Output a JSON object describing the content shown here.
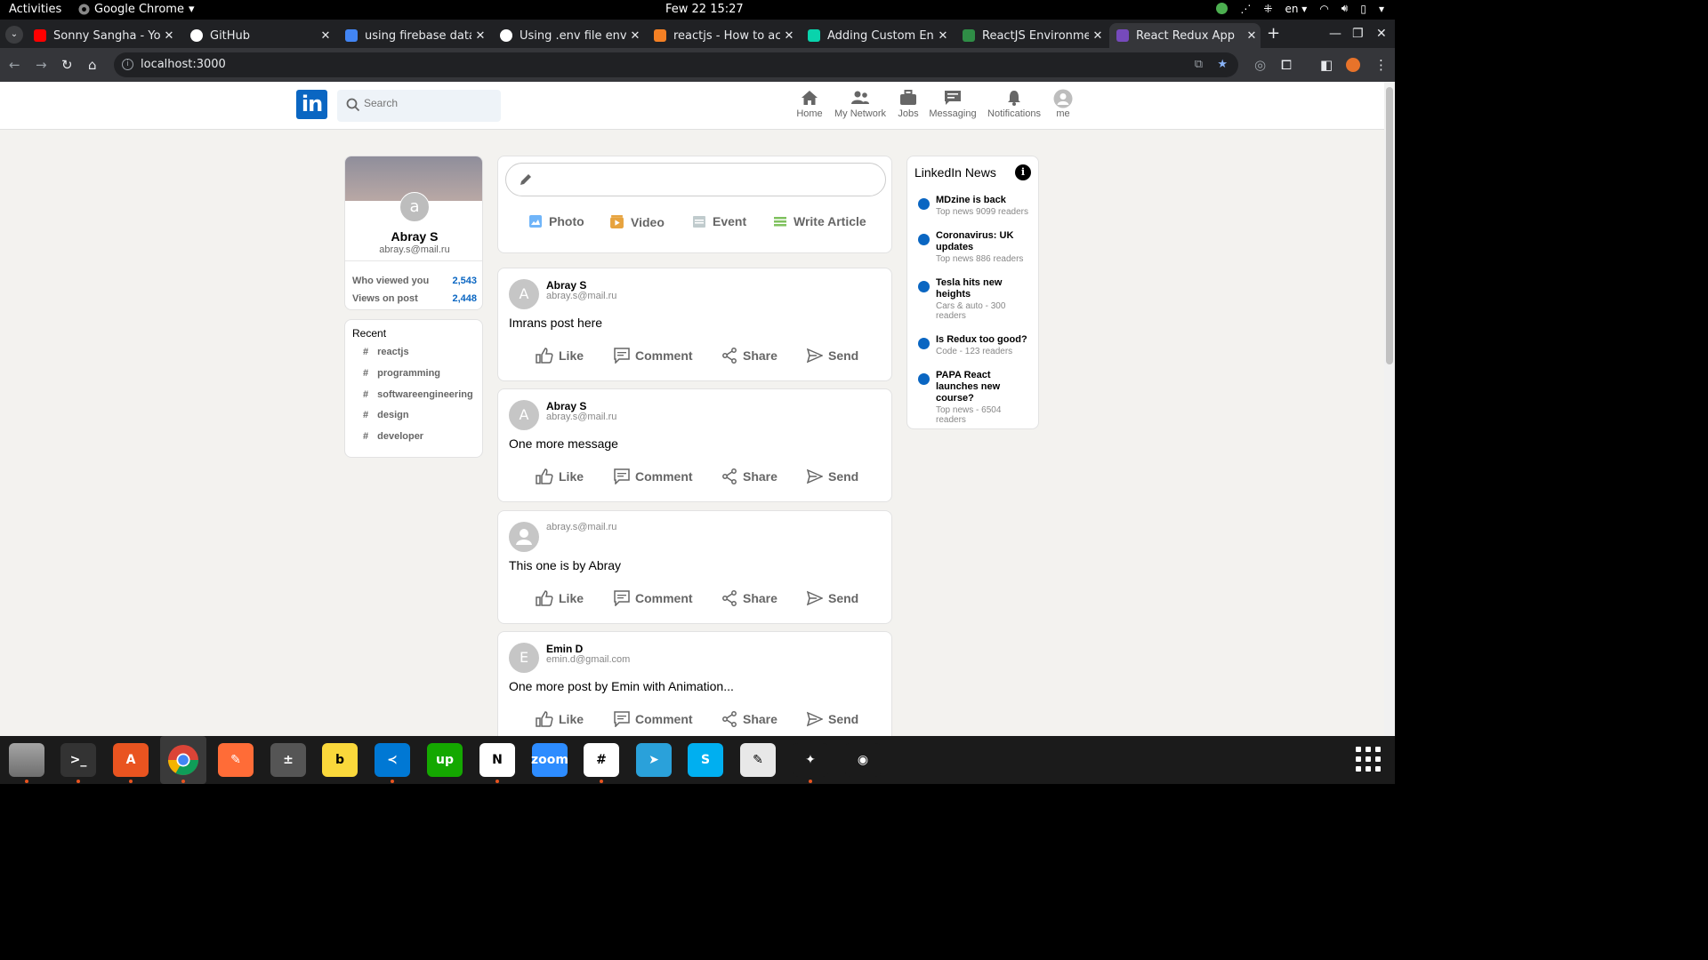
{
  "system": {
    "activities": "Activities",
    "app_name": "Google Chrome",
    "clock": "Few 22  15:27",
    "lang": "en"
  },
  "tabs": [
    {
      "title": "Sonny Sangha - YouT",
      "favicon": "youtube-icon",
      "color": "#ff0000"
    },
    {
      "title": "GitHub",
      "favicon": "github-icon",
      "color": "#ffffff"
    },
    {
      "title": "using firebase data a",
      "favicon": "google-icon",
      "color": "#4285f4"
    },
    {
      "title": "Using .env file enviro",
      "favicon": "github-icon",
      "color": "#ffffff"
    },
    {
      "title": "reactjs - How to acce",
      "favicon": "stackoverflow-icon",
      "color": "#f48024"
    },
    {
      "title": "Adding Custom Envi",
      "favicon": "create-react-app-icon",
      "color": "#09d3ac"
    },
    {
      "title": "ReactJS Environmen",
      "favicon": "geeksforgeeks-icon",
      "color": "#2f8d46"
    },
    {
      "title": "React Redux App",
      "favicon": "react-redux-icon",
      "color": "#764abc",
      "active": true
    }
  ],
  "toolbar": {
    "url": "localhost:3000"
  },
  "linkedin": {
    "logo_text": "in",
    "search_placeholder": "Search",
    "nav": [
      {
        "label": "Home",
        "icon": "home-icon"
      },
      {
        "label": "My Network",
        "icon": "network-icon"
      },
      {
        "label": "Jobs",
        "icon": "briefcase-icon"
      },
      {
        "label": "Messaging",
        "icon": "chat-icon"
      },
      {
        "label": "Notifications",
        "icon": "bell-icon"
      },
      {
        "label": "me",
        "icon": "user-avatar-icon"
      }
    ]
  },
  "profile": {
    "avatar_letter": "a",
    "name": "Abray S",
    "email": "abray.s@mail.ru",
    "stats": [
      {
        "label": "Who viewed you",
        "value": "2,543"
      },
      {
        "label": "Views on post",
        "value": "2,448"
      }
    ]
  },
  "recent": {
    "title": "Recent",
    "hash": "#",
    "items": [
      "reactjs",
      "programming",
      "softwareengineering",
      "design",
      "developer"
    ]
  },
  "share": {
    "options": [
      {
        "label": "Photo",
        "icon": "photo-icon",
        "color": "#70b5f9"
      },
      {
        "label": "Video",
        "icon": "video-icon",
        "color": "#e7a33e"
      },
      {
        "label": "Event",
        "icon": "calendar-icon",
        "color": "#c0cbcd"
      },
      {
        "label": "Write Article",
        "icon": "article-icon",
        "color": "#7fc15e"
      }
    ]
  },
  "post_actions": [
    "Like",
    "Comment",
    "Share",
    "Send"
  ],
  "posts": [
    {
      "avatar": "A",
      "name": "Abray S",
      "email": "abray.s@mail.ru",
      "message": "Imrans post here"
    },
    {
      "avatar": "A",
      "name": "Abray S",
      "email": "abray.s@mail.ru",
      "message": "One more message"
    },
    {
      "avatar": "",
      "name": "",
      "email": "abray.s@mail.ru",
      "message": "This one is by Abray"
    },
    {
      "avatar": "E",
      "name": "Emin D",
      "email": "emin.d@gmail.com",
      "message": "One more post by Emin with Animation..."
    }
  ],
  "news": {
    "title": "LinkedIn News",
    "info_glyph": "i",
    "items": [
      {
        "heading": "MDzine is back",
        "sub": "Top news 9099 readers"
      },
      {
        "heading": "Coronavirus: UK updates",
        "sub": "Top news 886 readers"
      },
      {
        "heading": "Tesla hits new heights",
        "sub": "Cars & auto - 300 readers"
      },
      {
        "heading": "Is Redux too good?",
        "sub": "Code - 123 readers"
      },
      {
        "heading": "PAPA React launches new course?",
        "sub": "Top news - 6504 readers"
      }
    ]
  },
  "dock": [
    {
      "name": "files-app-icon",
      "color": "#8a8a8a",
      "glyph": ""
    },
    {
      "name": "terminal-app-icon",
      "color": "#333333",
      "glyph": ">_"
    },
    {
      "name": "app-center-icon",
      "color": "#e95420",
      "glyph": "A"
    },
    {
      "name": "chrome-app-icon",
      "color": "#4285f4",
      "glyph": ""
    },
    {
      "name": "postman-app-icon",
      "color": "#ff6c37",
      "glyph": "✎"
    },
    {
      "name": "calculator-app-icon",
      "color": "#555555",
      "glyph": "±"
    },
    {
      "name": "beekeeper-app-icon",
      "color": "#fad83b",
      "glyph": "b"
    },
    {
      "name": "vscode-app-icon",
      "color": "#0078d4",
      "glyph": "≺"
    },
    {
      "name": "upwork-app-icon",
      "color": "#14a800",
      "glyph": "up"
    },
    {
      "name": "notion-app-icon",
      "color": "#ffffff",
      "glyph": "N"
    },
    {
      "name": "zoom-app-icon",
      "color": "#2d8cff",
      "glyph": "zoom"
    },
    {
      "name": "slack-app-icon",
      "color": "#ffffff",
      "glyph": "#"
    },
    {
      "name": "telegram-app-icon",
      "color": "#2aa1da",
      "glyph": "➤"
    },
    {
      "name": "skype-app-icon",
      "color": "#00aff0",
      "glyph": "S"
    },
    {
      "name": "text-editor-app-icon",
      "color": "#e8e8e8",
      "glyph": "✎"
    },
    {
      "name": "kite-app-icon",
      "color": "#1b1b1b",
      "glyph": "✦"
    },
    {
      "name": "screenshot-app-icon",
      "color": "#1b1b1b",
      "glyph": "◉"
    }
  ]
}
